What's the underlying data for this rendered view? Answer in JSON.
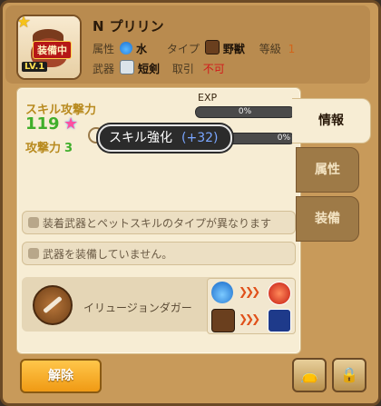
{
  "header": {
    "rank": "N",
    "name": "プリリン",
    "equipped_tag": "装備中",
    "level": "LV.1",
    "attribute_label": "属性",
    "attribute_value": "水",
    "type_label": "タイプ",
    "type_value": "野獣",
    "grade_label": "等級",
    "grade_value": "1",
    "weapon_label": "武器",
    "weapon_value": "短剣",
    "trade_label": "取引",
    "trade_value": "不可"
  },
  "stats": {
    "skill_attack_label": "スキル攻撃力",
    "skill_attack_value": "119",
    "attack_label": "攻撃力",
    "attack_value": "3",
    "exp_label": "EXP",
    "exp_percent": "0%",
    "second_bar_percent": "0%"
  },
  "tooltip": {
    "text": "スキル強化",
    "bonus": "(+32)"
  },
  "tabs": [
    "情報",
    "属性",
    "装備"
  ],
  "messages": [
    "装着武器とペットスキルのタイプが異なります",
    "武器を装備していません。"
  ],
  "weapon": {
    "name": "イリュージョンダガー"
  },
  "buttons": {
    "release": "解除"
  },
  "colors": {
    "panel": "#c89a5a",
    "accent_green": "#3fae2a",
    "accent_gold": "#b88a1e",
    "untradeable_red": "#d21a1a"
  }
}
